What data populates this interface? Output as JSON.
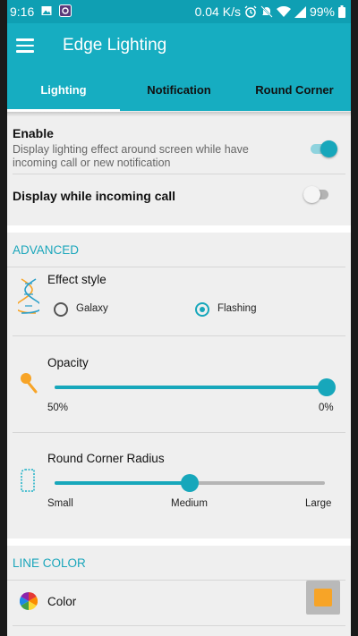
{
  "status_bar": {
    "time": "9:16",
    "speed": "0.04 K/s",
    "battery": "99%"
  },
  "app_bar": {
    "title": "Edge Lighting"
  },
  "tabs": [
    {
      "label": "Lighting",
      "active": true
    },
    {
      "label": "Notification",
      "active": false
    },
    {
      "label": "Round Corner",
      "active": false
    }
  ],
  "enable": {
    "title": "Enable",
    "subtitle_line1": "Display lighting effect around screen while have",
    "subtitle_line2": "incoming call or new notification",
    "on": true
  },
  "incoming_call": {
    "title": "Display while incoming call",
    "on": false
  },
  "advanced": {
    "header": "ADVANCED",
    "effect_style": {
      "title": "Effect style",
      "options": [
        {
          "label": "Galaxy",
          "selected": false
        },
        {
          "label": "Flashing",
          "selected": true
        }
      ]
    },
    "opacity": {
      "title": "Opacity",
      "min_label": "50%",
      "max_label": "0%",
      "value_fraction": 1.0
    },
    "round_corner_radius": {
      "title": "Round Corner Radius",
      "min_label": "Small",
      "mid_label": "Medium",
      "max_label": "Large",
      "value_fraction": 0.5
    }
  },
  "line_color": {
    "header": "LINE COLOR",
    "color_label": "Color",
    "selected_color": "#f7a427"
  },
  "colors": {
    "accent": "#16adc1",
    "switch_on": "#17a7bb"
  }
}
